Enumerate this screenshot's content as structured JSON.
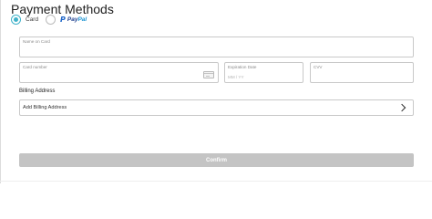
{
  "title": "Payment Methods",
  "methods": {
    "card_label": "Card",
    "paypal_logo_mark": "P",
    "paypal_logo_text_1": "Pay",
    "paypal_logo_text_2": "Pal",
    "selected": "Card"
  },
  "fields": {
    "name_label": "Name on Card",
    "number_label": "Card number",
    "expiry_label": "Expiration Date",
    "expiry_placeholder": "MM / YY",
    "cvv_label": "CVV"
  },
  "billing": {
    "label": "Billing Address",
    "add_label": "Add Billing Address"
  },
  "confirm_label": "Confirm",
  "colors": {
    "accent": "#3fb2c9",
    "paypal_dark": "#1e3f8f",
    "paypal_light": "#1e95d3",
    "button_disabled": "#c4c4c4"
  }
}
